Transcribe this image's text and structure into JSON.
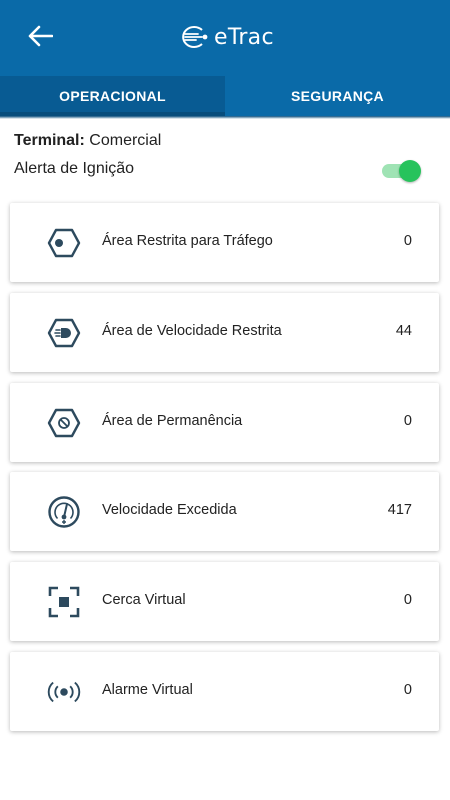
{
  "header": {
    "logo_text": "eTrac"
  },
  "tabs": [
    {
      "label": "OPERACIONAL",
      "active": true
    },
    {
      "label": "SEGURANÇA",
      "active": false
    }
  ],
  "terminal": {
    "label": "Terminal:",
    "value": "Comercial"
  },
  "ignition_alert": {
    "label": "Alerta de Ignição",
    "enabled": true
  },
  "items": [
    {
      "icon": "restricted-area-icon",
      "label": "Área Restrita para Tráfego",
      "count": "0"
    },
    {
      "icon": "speed-restricted-area-icon",
      "label": "Área de Velocidade Restrita",
      "count": "44"
    },
    {
      "icon": "permanence-area-icon",
      "label": "Área de Permanência",
      "count": "0"
    },
    {
      "icon": "speedometer-icon",
      "label": "Velocidade Excedida",
      "count": "417"
    },
    {
      "icon": "virtual-fence-icon",
      "label": "Cerca Virtual",
      "count": "0"
    },
    {
      "icon": "virtual-alarm-icon",
      "label": "Alarme Virtual",
      "count": "0"
    }
  ],
  "colors": {
    "primary": "#0a6aa8",
    "icon": "#2d4a5e",
    "toggle_on": "#27c35c"
  }
}
